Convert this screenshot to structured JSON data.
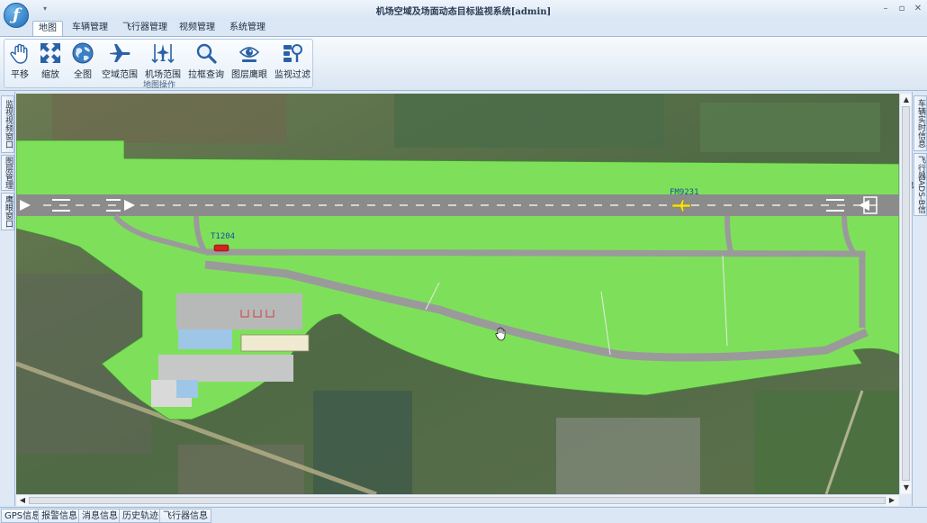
{
  "window": {
    "title": "机场空域及场面动态目标监视系统[admin]",
    "controls": [
      "–",
      "▫",
      "✕"
    ]
  },
  "tabs": [
    {
      "label": "地图",
      "active": true
    },
    {
      "label": "车辆管理"
    },
    {
      "label": "飞行器管理"
    },
    {
      "label": "视频管理"
    },
    {
      "label": "系统管理"
    }
  ],
  "ribbon": {
    "group_label": "地图操作",
    "buttons": [
      {
        "label": "平移",
        "icon": "hand-pan-icon"
      },
      {
        "label": "缩放",
        "icon": "zoom-arrows-icon"
      },
      {
        "label": "全图",
        "icon": "globe-icon"
      },
      {
        "label": "空域范围",
        "icon": "airplane-icon"
      },
      {
        "label": "机场范围",
        "icon": "airport-range-icon"
      },
      {
        "label": "拉框查询",
        "icon": "magnifier-icon"
      },
      {
        "label": "图层鹰眼",
        "icon": "eagle-eye-icon"
      },
      {
        "label": "监视过滤",
        "icon": "filter-icon"
      }
    ]
  },
  "left_tabs": [
    "监视视频窗口",
    "图层管理",
    "鹰眼窗口"
  ],
  "right_tabs": [
    "车辆实时信息",
    "飞行器ADS-B信息"
  ],
  "map": {
    "aircraft_label": "FM9231",
    "vehicle_label": "T1204",
    "colors": {
      "grass": "#7ee05a",
      "runway": "#8b8b8b",
      "taxiway": "#9a9a9a",
      "aircraft": "#f0e020",
      "vehicle": "#d42020"
    }
  },
  "bottom_tabs": [
    "GPS信息",
    "报警信息",
    "消息信息",
    "历史轨迹",
    "飞行器信息"
  ]
}
